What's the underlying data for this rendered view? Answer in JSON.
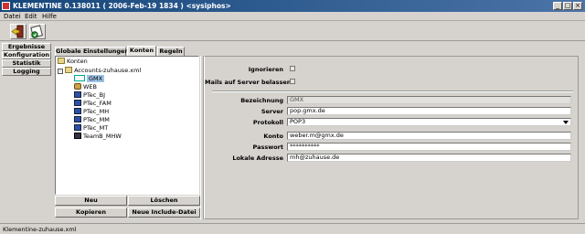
{
  "window": {
    "title": "KLEMENTINE 0.138011 ( 2006-Feb-19 1834 ) <sysiphos>",
    "minimize": "_",
    "maximize": "□",
    "close": "×"
  },
  "menu": [
    "Datei",
    "Edit",
    "Hilfe"
  ],
  "toolbar": [
    {
      "icon": "exit-door-icon"
    },
    {
      "icon": "edit-document-icon"
    }
  ],
  "sidebar": {
    "items": [
      "Ergebnisse",
      "Konfiguration",
      "Statistik",
      "Logging"
    ],
    "active": "Konfiguration"
  },
  "tabs": [
    "Globale Einstellungen",
    "Konten",
    "Regeln"
  ],
  "active_tab": "Konten",
  "tree": {
    "root": "Konten",
    "file": "Accounts-zuhause.xml",
    "accounts": [
      "GMX",
      "WEB",
      "PTec_BJ",
      "PTec_FAM",
      "PTec_MH",
      "PTec_MM",
      "PTec_MT",
      "TeamB_MHW"
    ],
    "selected": "GMX"
  },
  "buttons": {
    "new": "Neu",
    "delete": "Löschen",
    "copy": "Kopieren",
    "new_include": "Neue Include-Datei"
  },
  "details": {
    "ignore_label": "Ignorieren",
    "ignore_checked": false,
    "keep_mail_label": "Mails auf Server belassen",
    "keep_mail_checked": false,
    "name_label": "Bezeichnung",
    "name_value": "GMX",
    "server_label": "Server",
    "server_value": "pop.gmx.de",
    "protocol_label": "Protokoll",
    "protocol_value": "POP3",
    "account_label": "Konto",
    "account_value": "weber.m@gmx.de",
    "password_label": "Passwort",
    "password_value": "**********",
    "local_address_label": "Lokale Adresse",
    "local_address_value": "mh@zuhause.de"
  },
  "status": "Klementine-zuhause.xml"
}
